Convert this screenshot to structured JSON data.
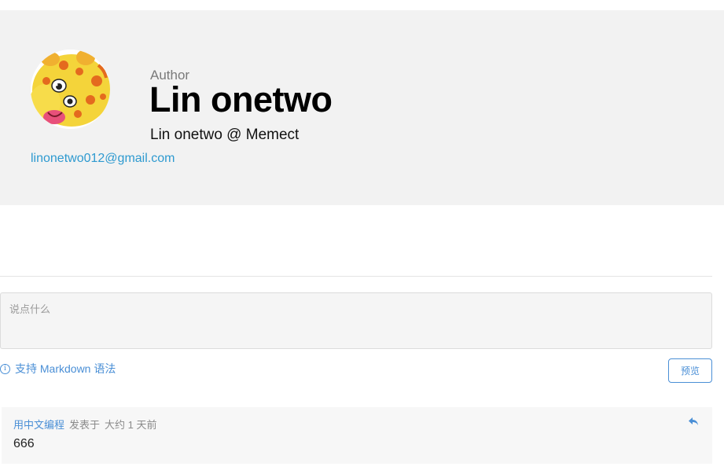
{
  "author": {
    "role": "Author",
    "name": "Lin onetwo",
    "bio": "Lin onetwo @ Memect",
    "email": "linonetwo012@gmail.com",
    "avatar_icon": "cartoon-tiger-avatar"
  },
  "comment_form": {
    "placeholder": "说点什么",
    "markdown_hint": "支持 Markdown 语法",
    "info_icon": "ⓘ",
    "preview_label": "预览"
  },
  "comments": [
    {
      "author": "用中文编程",
      "posted_label": "发表于",
      "time": "大约 1 天前",
      "body": "666",
      "reply_icon": "reply-arrow-icon"
    }
  ],
  "colors": {
    "accent": "#4a8fd6",
    "email": "#2e9ad0",
    "card_bg": "#f2f2f2"
  }
}
